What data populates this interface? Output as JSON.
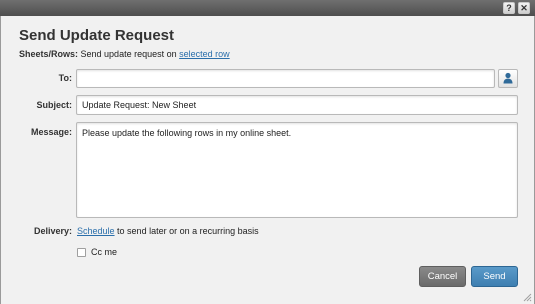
{
  "window": {
    "help_glyph": "?",
    "close_glyph": "✕"
  },
  "dialog": {
    "title": "Send Update Request",
    "sheet_rows": {
      "label": "Sheets/Rows:",
      "text": "Send update request on",
      "link": "selected row"
    },
    "to": {
      "label": "To:",
      "value": "",
      "contact_icon": "person-icon"
    },
    "subject": {
      "label": "Subject:",
      "value": "Update Request: New Sheet"
    },
    "message": {
      "label": "Message:",
      "value": "Please update the following rows in my online sheet."
    },
    "delivery": {
      "label": "Delivery:",
      "link": "Schedule",
      "text": "to send later or on a recurring basis"
    },
    "cc_me": {
      "label": "Cc me",
      "checked": false
    },
    "buttons": {
      "cancel": "Cancel",
      "send": "Send"
    }
  },
  "colors": {
    "accent": "#3e7fb1",
    "link": "#2b6fab",
    "cancel_button": "#6a6a6a"
  }
}
